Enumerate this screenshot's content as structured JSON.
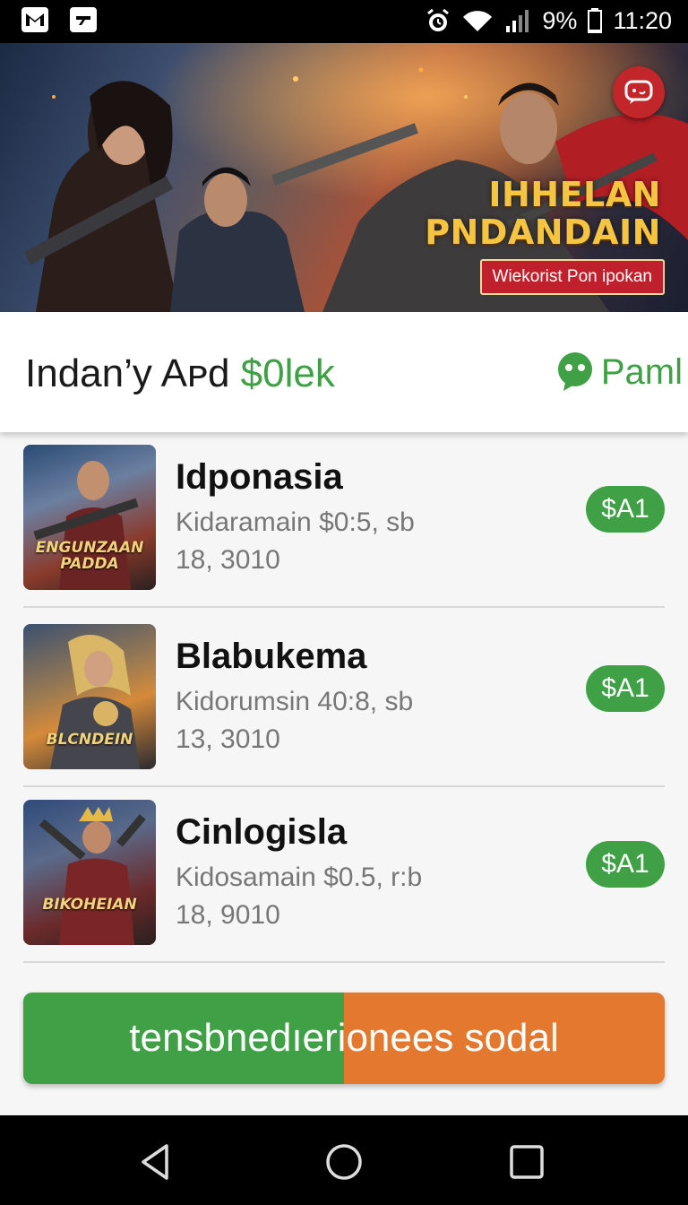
{
  "status_bar": {
    "battery": "9%",
    "time": "11:20",
    "icons": [
      "gmail-icon",
      "app-icon",
      "alarm-icon",
      "wifi-icon",
      "signal-icon",
      "battery-icon"
    ]
  },
  "banner": {
    "title_line1": "IHHELAN",
    "title_line2": "PNDANDAIN",
    "cta": "Wiekorist Pon ipokan"
  },
  "header": {
    "title": "Indan’y Aᴘd ",
    "title_accent": "$0lek",
    "chat_label": "Paml"
  },
  "items": [
    {
      "name": "Idponasia",
      "sub": "Kidaramain  $0:5, sb",
      "date": "18, 3010",
      "price": "$A1",
      "thumb_text": "ENGUNZAAN PADDA"
    },
    {
      "name": "Blabukema",
      "sub": "Kidorumsin  40:8, sb",
      "date": "13, 3010",
      "price": "$A1",
      "thumb_text": "BLCNDEIN"
    },
    {
      "name": "Cinlogisla",
      "sub": "Kidosamain  $0.5, r:b",
      "date": "18, 9010",
      "price": "$A1",
      "thumb_text": "BIKOHEIAN"
    }
  ],
  "cta_button": "tensbnedıerionees sodal",
  "colors": {
    "accent_green": "#3fa046",
    "accent_orange": "#e5782f",
    "banner_red": "#c2262a"
  }
}
